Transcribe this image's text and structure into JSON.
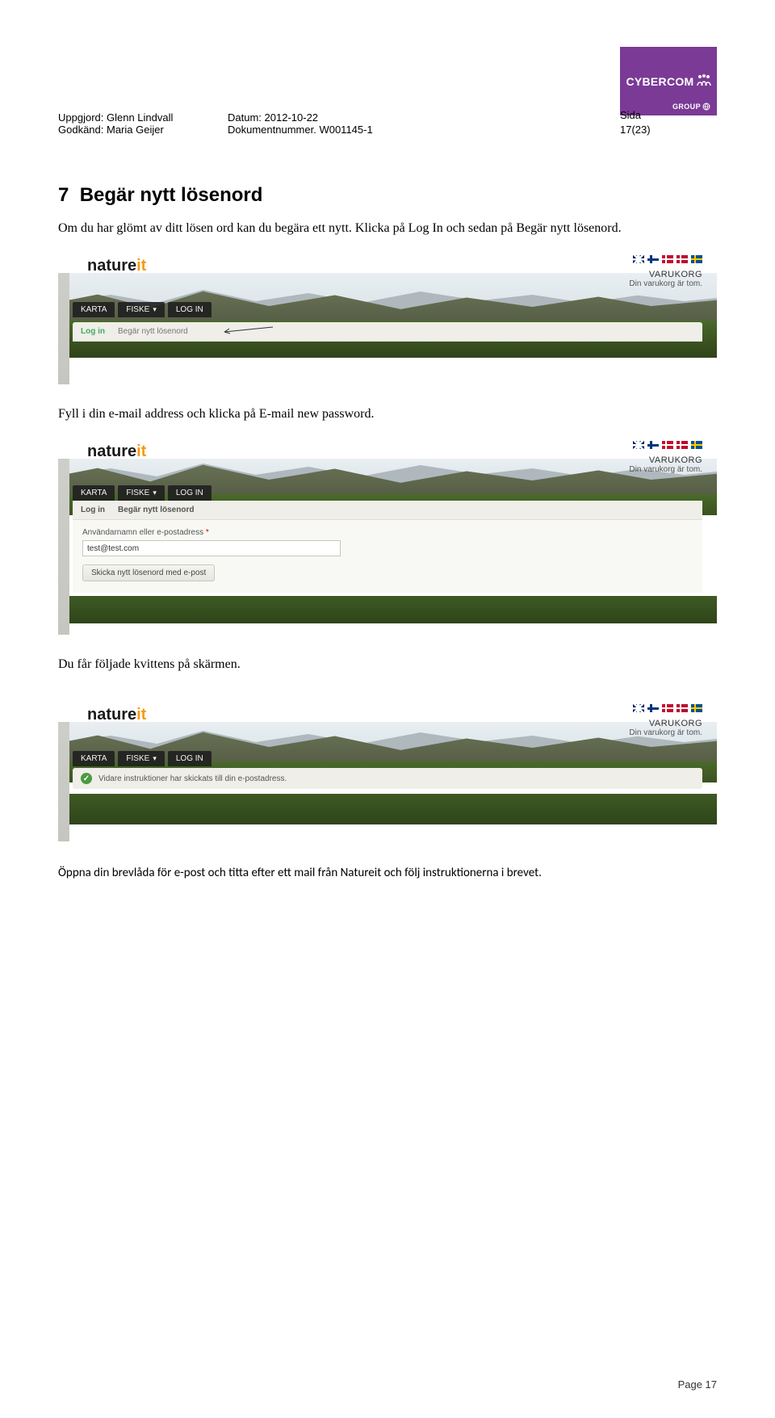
{
  "header": {
    "uppgjord_label": "Uppgjord:",
    "uppgjord_value": "Glenn Lindvall",
    "godkand_label": "Godkänd:",
    "godkand_value": "Maria Geijer",
    "datum_label": "Datum:",
    "datum_value": "2012-10-22",
    "doknr_label": "Dokumentnummer.",
    "doknr_value": "W001145-1",
    "sida_label": "Sida",
    "sida_value": "17(23)",
    "logo_text": "CYBERCOM",
    "logo_sub": "GROUP"
  },
  "section": {
    "heading_num": "7",
    "heading": "Begär nytt lösenord",
    "intro": "Om du har glömt av ditt lösen ord kan du begära ett nytt. Klicka på Log In och sedan på Begär nytt lösenord.",
    "para2": "Fyll i din e-mail address och klicka på E-mail new password.",
    "para3": "Du får följade kvittens på skärmen.",
    "para4": "Öppna din brevlåda för e-post och titta efter ett mail från Natureit och följ instruktionerna i brevet."
  },
  "shot_common": {
    "brand_nature": "nature",
    "brand_it": "it",
    "nav_karta": "KARTA",
    "nav_fiske": "FISKE",
    "nav_login": "LOG IN",
    "cart_title": "VARUKORG",
    "cart_empty": "Din varukorg är tom."
  },
  "shot1": {
    "tab_login": "Log in",
    "tab_reset": "Begär nytt lösenord"
  },
  "shot2": {
    "tab_login": "Log in",
    "tab_reset": "Begär nytt lösenord",
    "field_label": "Användarnamn eller e-postadress",
    "field_value": "test@test.com",
    "button": "Skicka nytt lösenord med e-post"
  },
  "shot3": {
    "success": "Vidare instruktioner har skickats till din e-postadress."
  },
  "footer": {
    "page": "Page 17"
  }
}
